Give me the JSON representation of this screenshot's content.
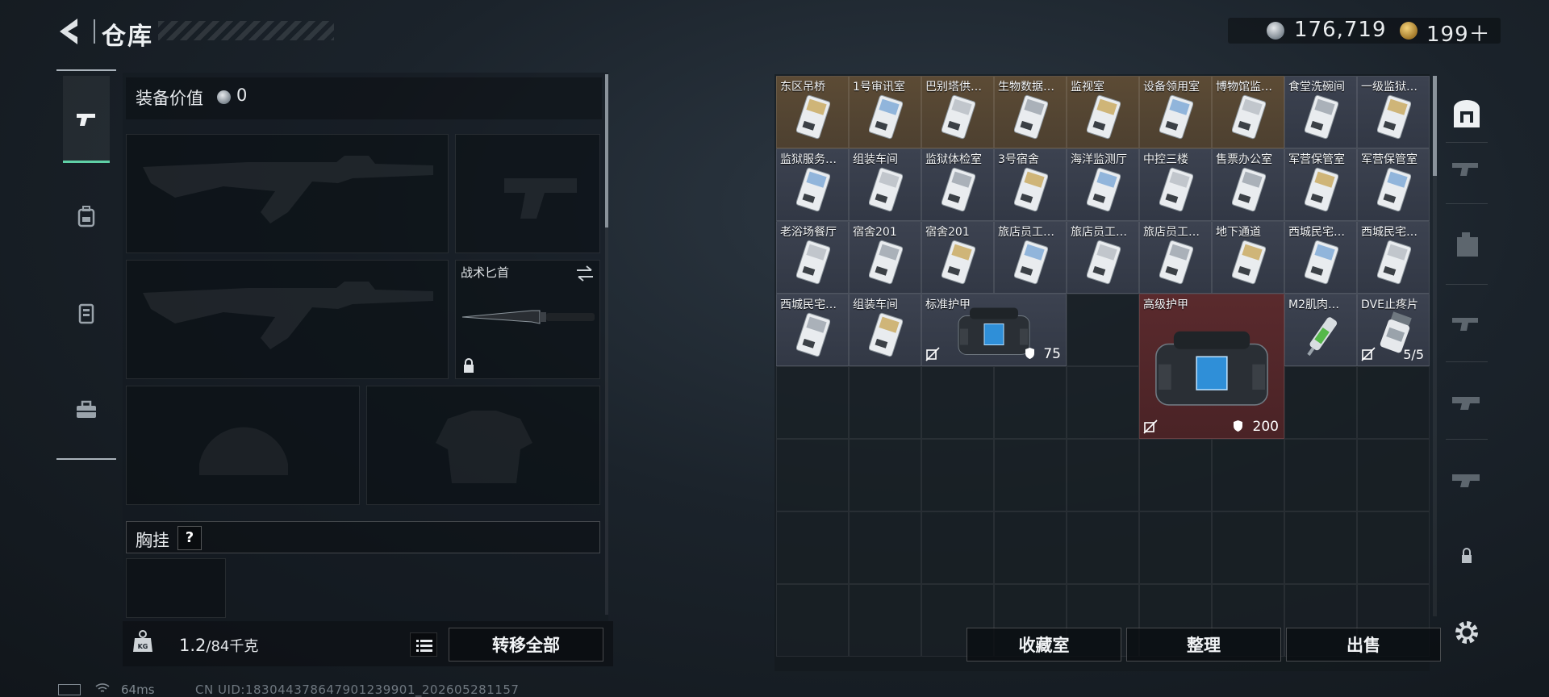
{
  "header": {
    "title": "仓库",
    "currency_silver": "176,719",
    "currency_gold": "199＋"
  },
  "equipment": {
    "value_label": "装备价值",
    "value_amount": "0",
    "knife_label": "战术匕首",
    "chest_label": "胸挂",
    "chest_help": "?"
  },
  "bottom_left": {
    "weight_current": "1.2",
    "weight_capacity": "/84千克",
    "transfer_all": "转移全部"
  },
  "status": {
    "ping": "64ms",
    "uid": "CN UID:1830443786479012399​01_202605281157"
  },
  "storage": {
    "items": [
      {
        "name": "东区吊桥",
        "color": "brown"
      },
      {
        "name": "1号审讯室",
        "color": "brown"
      },
      {
        "name": "巴别塔供…",
        "color": "brown"
      },
      {
        "name": "生物数据…",
        "color": "brown"
      },
      {
        "name": "监视室",
        "color": "brown"
      },
      {
        "name": "设备领用室",
        "color": "brown"
      },
      {
        "name": "博物馆监…",
        "color": "brown"
      },
      {
        "name": "食堂洗碗间",
        "color": "slate"
      },
      {
        "name": "一级监狱…",
        "color": "slate"
      },
      {
        "name": "监狱服务…",
        "color": "slate"
      },
      {
        "name": "组装车间",
        "color": "slate"
      },
      {
        "name": "监狱体检室",
        "color": "slate"
      },
      {
        "name": "3号宿舍",
        "color": "slate"
      },
      {
        "name": "海洋监测厅",
        "color": "slate"
      },
      {
        "name": "中控三楼",
        "color": "slate"
      },
      {
        "name": "售票办公室",
        "color": "slate"
      },
      {
        "name": "军营保管室",
        "color": "slate"
      },
      {
        "name": "军营保管室",
        "color": "slate"
      },
      {
        "name": "老浴场餐厅",
        "color": "slate"
      },
      {
        "name": "宿舍201",
        "color": "slate"
      },
      {
        "name": "宿舍201",
        "color": "slate"
      },
      {
        "name": "旅店员工…",
        "color": "slate"
      },
      {
        "name": "旅店员工…",
        "color": "slate"
      },
      {
        "name": "旅店员工…",
        "color": "slate"
      },
      {
        "name": "地下通道",
        "color": "slate"
      },
      {
        "name": "西城民宅…",
        "color": "slate"
      },
      {
        "name": "西城民宅…",
        "color": "slate"
      },
      {
        "name": "西城民宅…",
        "color": "slate"
      },
      {
        "name": "组装车间",
        "color": "slate"
      }
    ],
    "standard_armor": {
      "name": "标准护甲",
      "durability": "75"
    },
    "advanced_armor": {
      "name": "高级护甲",
      "durability": "200"
    },
    "m2": {
      "name": "M2肌肉…"
    },
    "dve": {
      "name": "DVE止疼片",
      "stack": "5/5"
    }
  },
  "actions": {
    "collection": "收藏室",
    "sort": "整理",
    "sell": "出售"
  },
  "colors": {
    "accent": "#5fd0a6",
    "brown_item": "#5c4b35",
    "slate_item": "#3c4250",
    "red_item": "#5a2a2d"
  },
  "icons": [
    "back-arrow-icon",
    "silver-coin-icon",
    "gold-coin-icon",
    "pistol-icon",
    "backpack-icon",
    "vest-icon",
    "toolbox-icon",
    "weight-icon",
    "list-icon",
    "safe-icon",
    "lock-icon",
    "gear-icon",
    "shield-icon",
    "no-drop-icon"
  ]
}
